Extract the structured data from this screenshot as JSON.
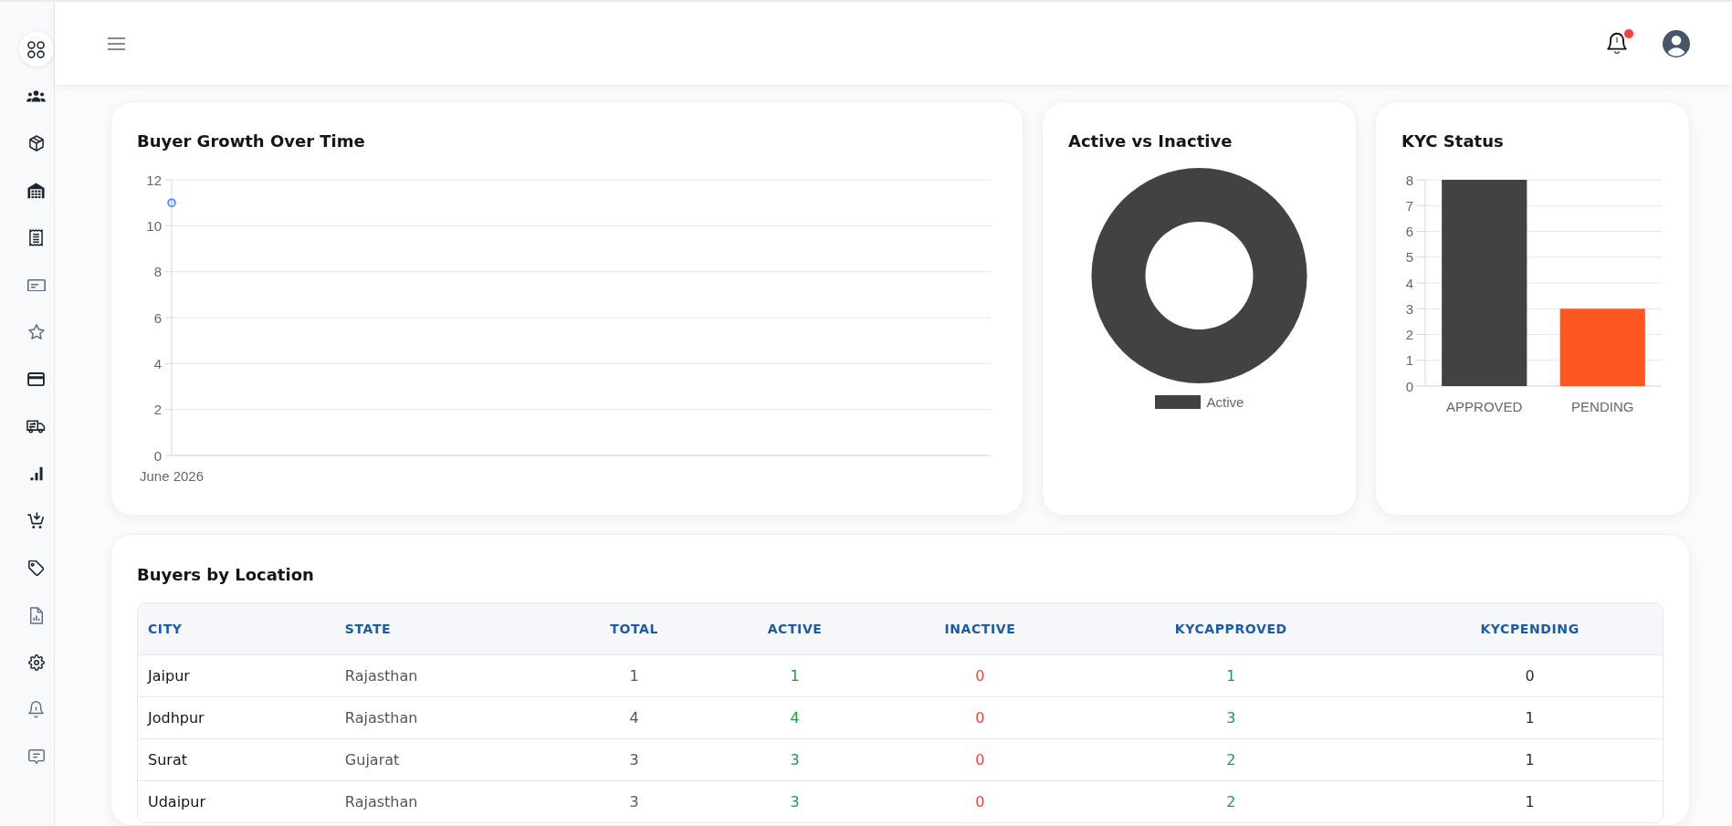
{
  "topbar": {
    "unread_notifications": true
  },
  "sidebar": {
    "items": [
      {
        "selected": true
      },
      {
        "selected": false
      },
      {
        "selected": false
      },
      {
        "selected": false
      },
      {
        "selected": false
      },
      {
        "selected": false
      },
      {
        "selected": false
      },
      {
        "selected": false
      },
      {
        "selected": false
      },
      {
        "selected": false
      },
      {
        "selected": false
      },
      {
        "selected": false
      },
      {
        "selected": false
      },
      {
        "selected": false
      },
      {
        "selected": false
      },
      {
        "selected": false
      }
    ]
  },
  "buyer_growth": {
    "chart_data": {
      "type": "line",
      "title": "Buyer Growth Over Time",
      "categories": [
        "June 2026"
      ],
      "series": [
        {
          "color": "#3b82f6",
          "marker": "circle",
          "values": [
            11
          ]
        }
      ],
      "ylim": [
        0,
        12
      ],
      "yticks": [
        0,
        2,
        4,
        6,
        8,
        10,
        12
      ],
      "grid": true
    }
  },
  "active_vs_inactive": {
    "chart_data": {
      "type": "donut",
      "title": "Active vs Inactive",
      "categories": [
        "Active"
      ],
      "values": [
        100
      ],
      "colors": [
        "#424242"
      ]
    }
  },
  "kyc_status": {
    "chart_data": {
      "type": "bar",
      "title": "KYC Status",
      "categories": [
        "APPROVED",
        "PENDING"
      ],
      "values": [
        8,
        3
      ],
      "colors": [
        "#424242",
        "#ff5722"
      ],
      "ylim": [
        0,
        8
      ],
      "yticks": [
        0,
        1,
        2,
        3,
        4,
        5,
        6,
        7,
        8
      ],
      "grid": true
    }
  },
  "buyers_by_location": {
    "title": "Buyers by Location",
    "columns": [
      {
        "label": "CITY",
        "kind": "name"
      },
      {
        "label": "STATE",
        "kind": "text"
      },
      {
        "label": "TOTAL",
        "kind": "count"
      },
      {
        "label": "ACTIVE",
        "kind": "positive"
      },
      {
        "label": "INACTIVE",
        "kind": "negative"
      },
      {
        "label": "KYCAPPROVED",
        "kind": "positive"
      },
      {
        "label": "KYCPENDING",
        "kind": "plain"
      }
    ],
    "rows": [
      [
        "Jaipur",
        "Rajasthan",
        "1",
        "1",
        "0",
        "1",
        "0"
      ],
      [
        "Jodhpur",
        "Rajasthan",
        "4",
        "4",
        "0",
        "3",
        "1"
      ],
      [
        "Surat",
        "Gujarat",
        "3",
        "3",
        "0",
        "2",
        "1"
      ],
      [
        "Udaipur",
        "Rajasthan",
        "3",
        "3",
        "0",
        "2",
        "1"
      ]
    ]
  }
}
